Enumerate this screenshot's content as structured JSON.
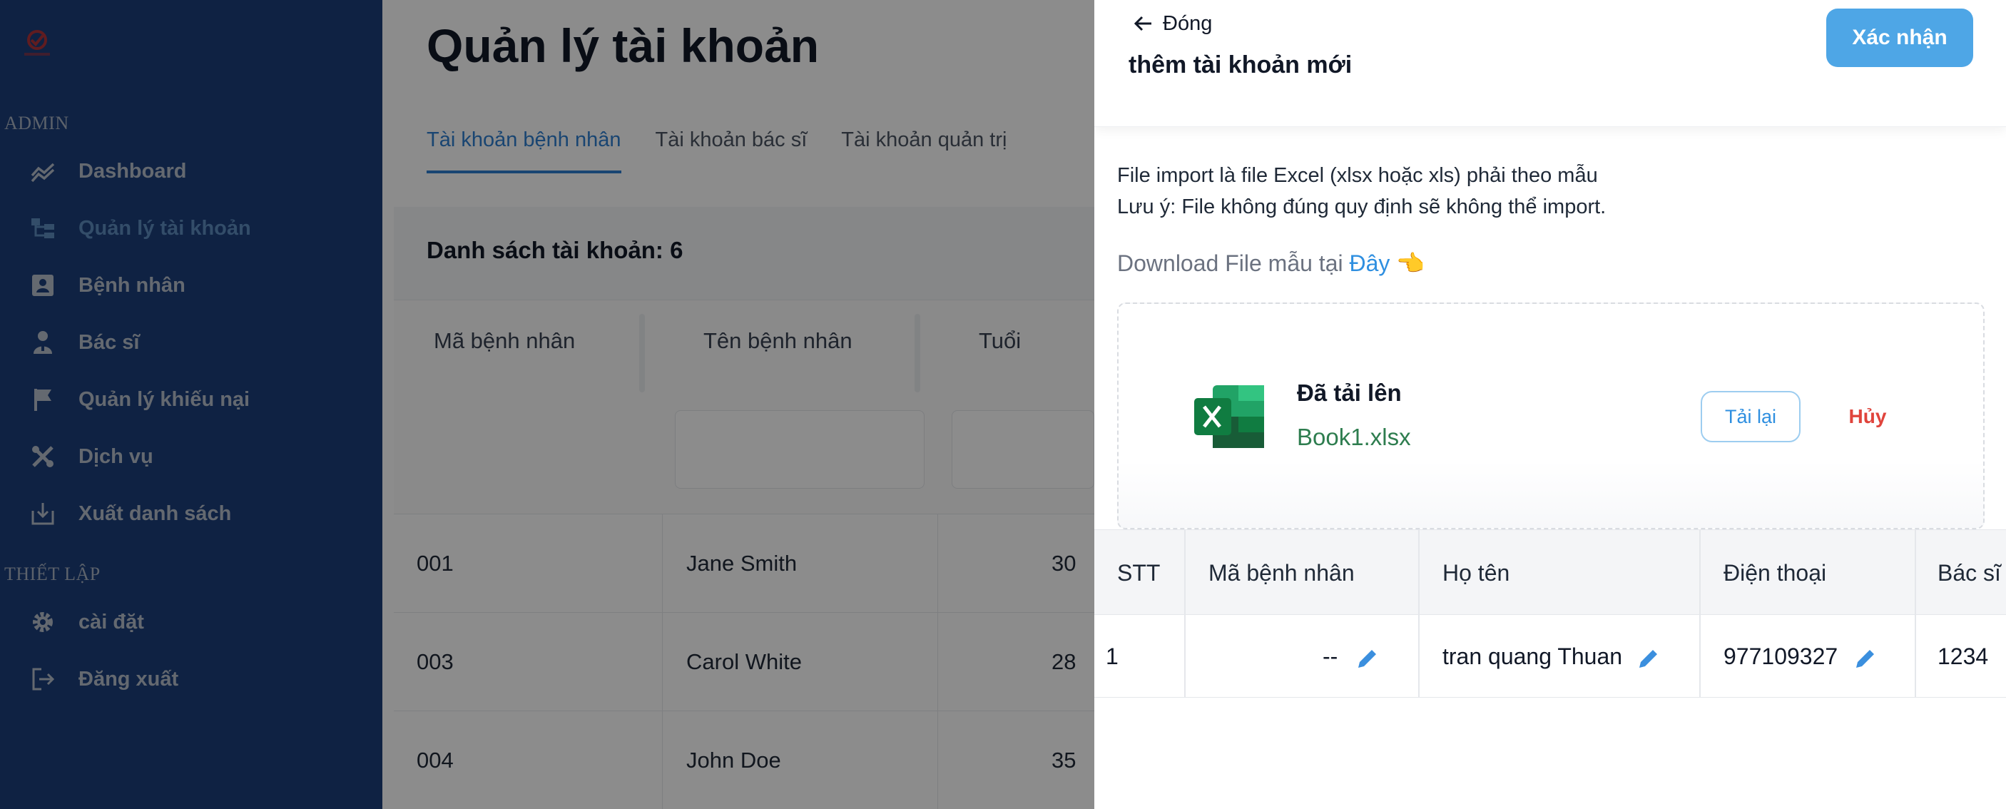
{
  "sidebar": {
    "sections": [
      "ADMIN",
      "THIẾT LẬP"
    ],
    "items": [
      {
        "label": "Dashboard",
        "icon": "chart-line-icon"
      },
      {
        "label": "Quản lý tài khoản",
        "icon": "accounts-tree-icon",
        "active": true
      },
      {
        "label": "Bệnh nhân",
        "icon": "patient-card-icon"
      },
      {
        "label": "Bác sĩ",
        "icon": "doctor-icon"
      },
      {
        "label": "Quản lý khiếu nại",
        "icon": "flag-icon"
      },
      {
        "label": "Dịch vụ",
        "icon": "tools-icon"
      },
      {
        "label": "Xuất danh sách",
        "icon": "download-icon"
      },
      {
        "label": "cài đặt",
        "icon": "gear-icon"
      },
      {
        "label": "Đăng xuất",
        "icon": "logout-icon"
      }
    ]
  },
  "main": {
    "title": "Quản lý tài khoản",
    "tabs": [
      "Tài khoản bệnh nhân",
      "Tài khoản bác sĩ",
      "Tài khoản quản trị"
    ],
    "list_title": "Danh sách tài khoản: 6",
    "columns": [
      "Mã bệnh nhân",
      "Tên bệnh nhân",
      "Tuổi"
    ],
    "rows": [
      {
        "id": "001",
        "name": "Jane Smith",
        "age": "30"
      },
      {
        "id": "003",
        "name": "Carol White",
        "age": "28"
      },
      {
        "id": "004",
        "name": "John Doe",
        "age": "35"
      }
    ]
  },
  "drawer": {
    "back_label": "Đóng",
    "title": "thêm tài khoản mới",
    "confirm_label": "Xác nhận",
    "note_line1": "File import là file Excel (xlsx hoặc xls) phải theo mẫu",
    "note_line2": "Lưu ý: File không đúng quy định sẽ không thể import.",
    "download_text": "Download File mẫu tại",
    "download_link": "Đây",
    "download_emoji": "👈",
    "upload": {
      "title": "Đã tải lên",
      "filename": "Book1.xlsx",
      "reload_label": "Tải lại",
      "cancel_label": "Hủy"
    },
    "table": {
      "columns": [
        "STT",
        "Mã bệnh nhân",
        "Họ tên",
        "Điện thoại",
        "Bác sĩ"
      ],
      "row": {
        "stt": "1",
        "code": "--",
        "name": "tran quang Thuan",
        "phone": "977109327",
        "doctor": "1234"
      }
    }
  },
  "colors": {
    "sidebar_bg": "#1c3e7a",
    "accent": "#4ea6e6",
    "danger": "#e0443c",
    "excel_green": "#2e7d4f"
  }
}
